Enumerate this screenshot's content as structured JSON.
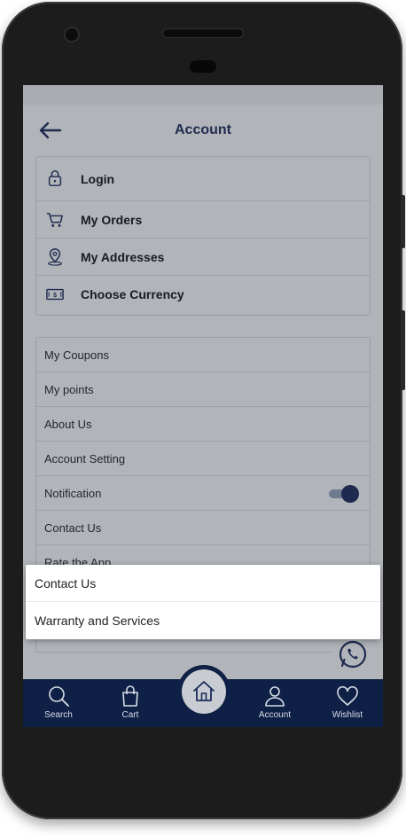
{
  "header": {
    "title": "Account",
    "back_icon": "arrow-left-icon"
  },
  "primary_menu": [
    {
      "label": "Login",
      "icon": "lock-icon"
    },
    {
      "label": "My Orders",
      "icon": "cart-icon"
    },
    {
      "label": "My Addresses",
      "icon": "location-pin-icon"
    },
    {
      "label": "Choose Currency",
      "icon": "banknote-icon"
    }
  ],
  "secondary_menu": [
    {
      "label": "My Coupons"
    },
    {
      "label": "My points"
    },
    {
      "label": "About Us"
    },
    {
      "label": "Account Setting"
    },
    {
      "label": "Notification",
      "toggle_on": true
    },
    {
      "label": "Contact Us"
    },
    {
      "label": "Rate the App"
    }
  ],
  "popup_menu": [
    {
      "label": "Contact Us"
    },
    {
      "label": "Warranty and Services"
    }
  ],
  "bottom_nav": [
    {
      "label": "Search",
      "icon": "search-icon"
    },
    {
      "label": "Cart",
      "icon": "shopping-bag-icon"
    },
    {
      "label": "Account",
      "icon": "user-icon"
    },
    {
      "label": "Wishlist",
      "icon": "heart-icon"
    }
  ],
  "home_icon": "home-icon",
  "colors": {
    "brand_navy": "#0f2046",
    "text_navy": "#1a2a5a",
    "overlay": "rgba(40,48,60,0.36)"
  }
}
